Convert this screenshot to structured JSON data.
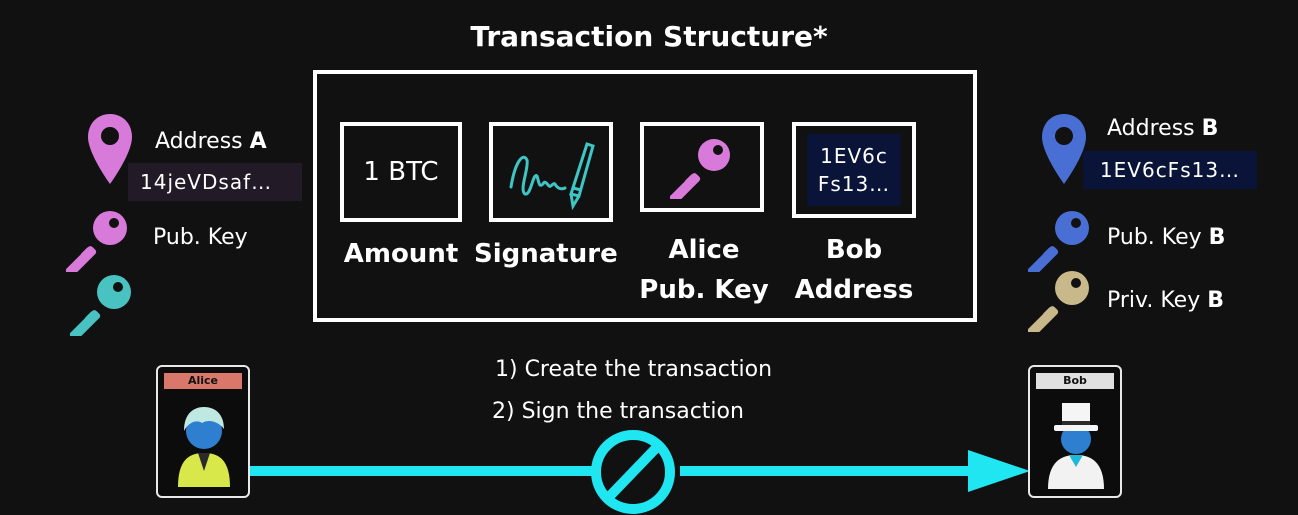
{
  "title": "Transaction Structure*",
  "left": {
    "address_prefix": "Address ",
    "address_letter": "A",
    "address_value": "14jeVDsaf…",
    "pubkey_label": "Pub. Key"
  },
  "right": {
    "address_prefix": "Address ",
    "address_letter": "B",
    "address_value": "1EV6cFs13…",
    "pubkey_prefix": "Pub. Key ",
    "pubkey_letter": "B",
    "privkey_prefix": "Priv. Key ",
    "privkey_letter": "B"
  },
  "fields": {
    "amount_value": "1 BTC",
    "amount_label": "Amount",
    "signature_label": "Signature",
    "alice_key_label_1": "Alice",
    "alice_key_label_2": "Pub. Key",
    "bob_addr_value_1": "1EV6c",
    "bob_addr_value_2": "Fs13…",
    "bob_addr_label_1": "Bob",
    "bob_addr_label_2": "Address"
  },
  "steps": [
    "1) Create the transaction",
    "2) Sign the transaction"
  ],
  "cards": {
    "alice": "Alice",
    "bob": "Bob"
  },
  "colors": {
    "pink": "#d77ad9",
    "teal": "#49c3c1",
    "blue": "#4a6fd4",
    "tan": "#c9b98a",
    "cyan": "#1fe6f0",
    "alice_tag": "#d9776b",
    "bob_tag": "#e0e0e0"
  },
  "icons": [
    "pin-icon-pink",
    "key-icon-pink",
    "key-icon-teal",
    "pin-icon-blue",
    "key-icon-blue",
    "key-icon-tan",
    "signature-icon",
    "prohibited-icon",
    "alice-avatar-icon",
    "bob-avatar-icon"
  ]
}
